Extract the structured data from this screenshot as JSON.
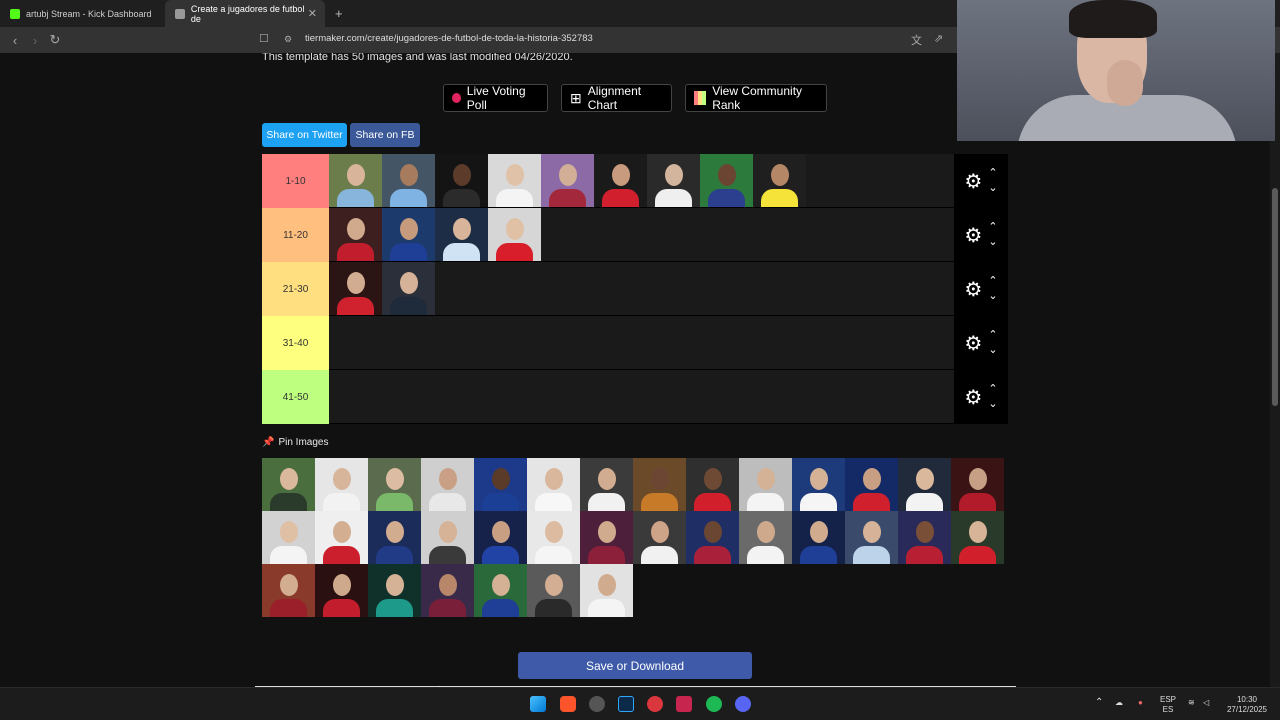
{
  "browser": {
    "tabs": [
      {
        "label": "artubj Stream - Kick Dashboard",
        "favicon_color": "#53fc18"
      },
      {
        "label": "Create a jugadores de futbol de",
        "favicon_color": "#999999"
      }
    ],
    "new_tab": "+",
    "close_tab": "✕",
    "url": "tiermaker.com/create/jugadores-de-futbol-de-toda-la-historia-352783"
  },
  "page": {
    "template_note": "This template has 50 images and was last modified 04/26/2020.",
    "top_buttons": {
      "live_poll": "Live Voting Poll",
      "alignment": "Alignment Chart",
      "community": "View Community Rank"
    },
    "share_twitter": "Share on Twitter",
    "share_fb": "Share on FB",
    "tiers": [
      {
        "label": "1-10",
        "color": "#ff7f7f",
        "items": [
          {
            "bg": "#6b7d4a",
            "face": "#d8b49a",
            "shirt": "#87b5dc"
          },
          {
            "bg": "#445566",
            "face": "#a77b5e",
            "shirt": "#7fb3e3"
          },
          {
            "bg": "#141414",
            "face": "#5d3b2a",
            "shirt": "#2b2b2b"
          },
          {
            "bg": "#d9d9d9",
            "face": "#e0c2a8",
            "shirt": "#f4f4f4"
          },
          {
            "bg": "#8c6aa6",
            "face": "#d2ae96",
            "shirt": "#a4283b"
          },
          {
            "bg": "#1a1a1a",
            "face": "#c99b7e",
            "shirt": "#d11f2d"
          },
          {
            "bg": "#2a2a2a",
            "face": "#d3b59e",
            "shirt": "#efefef"
          },
          {
            "bg": "#2c7a3c",
            "face": "#6b4532",
            "shirt": "#2c3f8f"
          },
          {
            "bg": "#1f1f1f",
            "face": "#b48766",
            "shirt": "#f5e33a"
          }
        ]
      },
      {
        "label": "11-20",
        "color": "#ffbf7f",
        "items": [
          {
            "bg": "#3d1f1f",
            "face": "#d1a98c",
            "shirt": "#c21d2c"
          },
          {
            "bg": "#1d3a6d",
            "face": "#c69a7c",
            "shirt": "#1f3e96"
          },
          {
            "bg": "#1d2d45",
            "face": "#d8b49a",
            "shirt": "#cfe3f5"
          },
          {
            "bg": "#d6d6d6",
            "face": "#e1c1a5",
            "shirt": "#d81e2a"
          }
        ]
      },
      {
        "label": "21-30",
        "color": "#ffdf7f",
        "items": [
          {
            "bg": "#2b1414",
            "face": "#d2ac90",
            "shirt": "#d0212e"
          },
          {
            "bg": "#2a2f3a",
            "face": "#d6b298",
            "shirt": "#1f2a3b"
          }
        ]
      },
      {
        "label": "31-40",
        "color": "#ffff7f",
        "items": []
      },
      {
        "label": "41-50",
        "color": "#bfff7f",
        "items": []
      }
    ],
    "tier_controls": {
      "up": "⌃",
      "down": "⌄"
    },
    "pin_label": "Pin Images",
    "pool": [
      {
        "bg": "#4a6e3e",
        "face": "#d9b89c",
        "shirt": "#2b3b2b"
      },
      {
        "bg": "#e6e6e6",
        "face": "#d7b59b",
        "shirt": "#f2f2f2"
      },
      {
        "bg": "#5a6b4e",
        "face": "#dcbca2",
        "shirt": "#7ab86a"
      },
      {
        "bg": "#cfcfcf",
        "face": "#c9a085",
        "shirt": "#e8e8e8"
      },
      {
        "bg": "#1d3a8a",
        "face": "#5a3a28",
        "shirt": "#1c3f96"
      },
      {
        "bg": "#e5e5e5",
        "face": "#d9b79c",
        "shirt": "#f7f7f7"
      },
      {
        "bg": "#3b3b3b",
        "face": "#d1ac90",
        "shirt": "#f1f1f1"
      },
      {
        "bg": "#6b4a2a",
        "face": "#6d4633",
        "shirt": "#c77b29"
      },
      {
        "bg": "#2f2f2f",
        "face": "#6e4a35",
        "shirt": "#d21f2c"
      },
      {
        "bg": "#bdbdbd",
        "face": "#d4b295",
        "shirt": "#f4f4f4"
      },
      {
        "bg": "#1d3a7a",
        "face": "#d5b196",
        "shirt": "#f5f5f5"
      },
      {
        "bg": "#142a66",
        "face": "#c99f84",
        "shirt": "#d1202d"
      },
      {
        "bg": "#202a3a",
        "face": "#d9b89c",
        "shirt": "#f3f3f3"
      },
      {
        "bg": "#3a1414",
        "face": "#c69f84",
        "shirt": "#b11b2a"
      },
      {
        "bg": "#d2d2d2",
        "face": "#e0c0a4",
        "shirt": "#f4f4f4"
      },
      {
        "bg": "#efefef",
        "face": "#d3ae91",
        "shirt": "#cc1f2d"
      },
      {
        "bg": "#1b2b5a",
        "face": "#d1ac8f",
        "shirt": "#223b86"
      },
      {
        "bg": "#cfcfcf",
        "face": "#d6b296",
        "shirt": "#3a3a3a"
      },
      {
        "bg": "#16224a",
        "face": "#c99f83",
        "shirt": "#2243a6"
      },
      {
        "bg": "#e8e8e8",
        "face": "#dcbba0",
        "shirt": "#f5f5f5"
      },
      {
        "bg": "#4d1f3a",
        "face": "#d1ab8e",
        "shirt": "#8c1f3a"
      },
      {
        "bg": "#3a3a3a",
        "face": "#cda487",
        "shirt": "#f1f1f1"
      },
      {
        "bg": "#1f2f66",
        "face": "#6b4633",
        "shirt": "#a8203a"
      },
      {
        "bg": "#6a6a6a",
        "face": "#cfa98c",
        "shirt": "#f3f3f3"
      },
      {
        "bg": "#14224a",
        "face": "#d1ab8e",
        "shirt": "#1f3f96"
      },
      {
        "bg": "#3a4a6a",
        "face": "#d6b398",
        "shirt": "#bcd3ea"
      },
      {
        "bg": "#2a2a5a",
        "face": "#7a4f38",
        "shirt": "#b81f33"
      },
      {
        "bg": "#2a3a2a",
        "face": "#d7b397",
        "shirt": "#d11f2b"
      },
      {
        "bg": "#8a3a2a",
        "face": "#d2ad90",
        "shirt": "#9a1f2a"
      },
      {
        "bg": "#2a1010",
        "face": "#cfa98c",
        "shirt": "#c21d2c"
      },
      {
        "bg": "#10302a",
        "face": "#d5b296",
        "shirt": "#1e9a8a"
      },
      {
        "bg": "#3a2a4a",
        "face": "#b8876a",
        "shirt": "#7a1f3a"
      },
      {
        "bg": "#2a6a3a",
        "face": "#d4b095",
        "shirt": "#1f3f96"
      },
      {
        "bg": "#5a5a5a",
        "face": "#d3ae92",
        "shirt": "#2a2a2a"
      },
      {
        "bg": "#e2e2e2",
        "face": "#d1ab8e",
        "shirt": "#f4f4f4"
      }
    ],
    "save_button": "Save or Download"
  },
  "taskbar": {
    "lang_top": "ESP",
    "lang_bottom": "ES",
    "time": "10:30",
    "date": "27/12/2025"
  }
}
